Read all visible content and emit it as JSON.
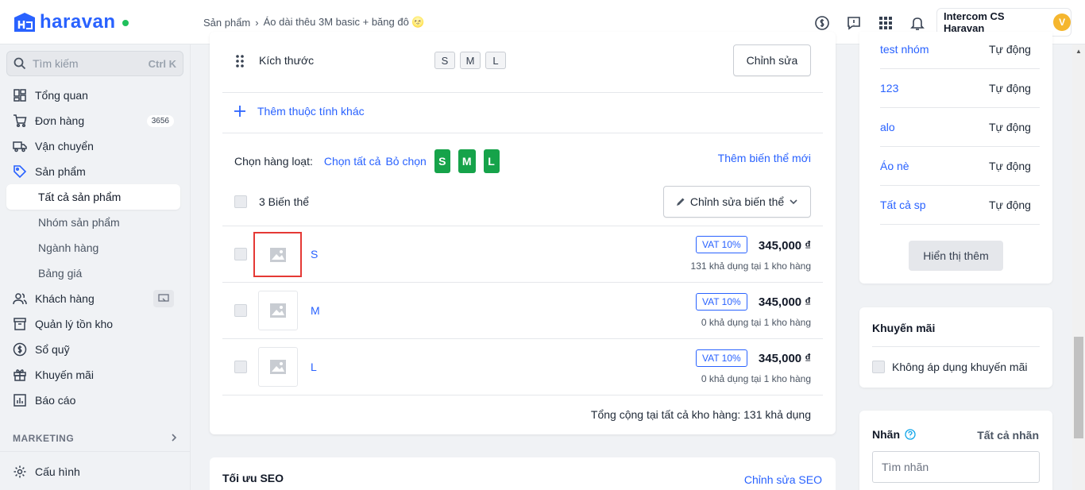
{
  "app": {
    "logo_text": "haravan",
    "brand_color": "#2962ff"
  },
  "breadcrumb": {
    "section": "Sản phẩm",
    "separator": "›",
    "current": "Áo dài thêu 3M basic + băng đô 🌝"
  },
  "account": {
    "name": "Intercom CS Haravan",
    "avatar_letter": "V"
  },
  "search": {
    "placeholder": "Tìm kiếm",
    "shortcut": "Ctrl K"
  },
  "nav": {
    "overview": "Tổng quan",
    "orders": "Đơn hàng",
    "orders_badge": "3656",
    "shipping": "Vận chuyển",
    "products": "Sản phẩm",
    "all_products": "Tất cả sản phẩm",
    "product_groups": "Nhóm sản phẩm",
    "categories": "Ngành hàng",
    "price_list": "Bảng giá",
    "customers": "Khách hàng",
    "inventory": "Quản lý tồn kho",
    "cashbook": "Sổ quỹ",
    "promotions": "Khuyến mãi",
    "reports": "Báo cáo",
    "marketing_label": "MARKETING",
    "settings": "Cấu hình"
  },
  "attributes": {
    "size_label": "Kích thước",
    "size_values": [
      "S",
      "M",
      "L"
    ],
    "edit_button": "Chỉnh sửa",
    "add_attribute": "Thêm thuộc tính khác"
  },
  "bulk": {
    "label": "Chọn hàng loạt:",
    "select_all": "Chọn tất cả",
    "deselect": "Bỏ chọn",
    "chips": [
      "S",
      "M",
      "L"
    ],
    "add_variant": "Thêm biến thể mới"
  },
  "variants": {
    "count_label": "3 Biến thể",
    "edit_variants_button": "Chỉnh sửa biến thể",
    "rows": [
      {
        "name": "S",
        "vat": "VAT 10%",
        "price": "345,000 ₫",
        "stock": "131 khả dụng tại 1 kho hàng"
      },
      {
        "name": "M",
        "vat": "VAT 10%",
        "price": "345,000 ₫",
        "stock": "0 khả dụng tại 1 kho hàng"
      },
      {
        "name": "L",
        "vat": "VAT 10%",
        "price": "345,000 ₫",
        "stock": "0 khả dụng tại 1 kho hàng"
      }
    ],
    "total": "Tổng cộng tại tất cả kho hàng: 131 khả dụng"
  },
  "seo": {
    "title": "Tối ưu SEO",
    "edit_link": "Chỉnh sửa SEO"
  },
  "collections": {
    "rows": [
      {
        "name": "test nhóm",
        "mode": "Tự động"
      },
      {
        "name": "123",
        "mode": "Tự động"
      },
      {
        "name": "alo",
        "mode": "Tự động"
      },
      {
        "name": "Áo nè",
        "mode": "Tự động"
      },
      {
        "name": "Tất cả sp",
        "mode": "Tự động"
      }
    ],
    "show_more": "Hiển thị thêm"
  },
  "promotion": {
    "title": "Khuyến mãi",
    "no_apply": "Không áp dụng khuyến mãi"
  },
  "tags": {
    "title": "Nhãn",
    "all_tags": "Tất cả nhãn",
    "placeholder": "Tìm nhãn"
  }
}
